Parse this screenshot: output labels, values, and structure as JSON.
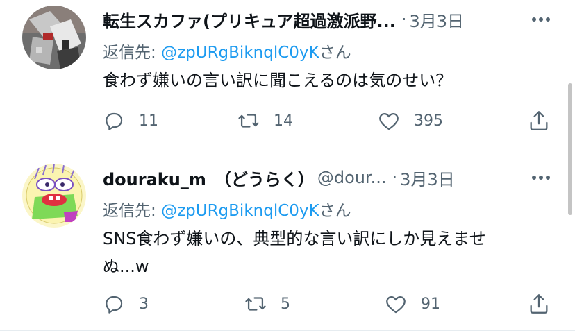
{
  "tweets": [
    {
      "name": "転生スカファ(プリキュア超過激派野...",
      "handle": "",
      "dot": "·",
      "date": "3月3日",
      "reply_prefix": "返信先: ",
      "reply_to": "@zpURgBiknqlC0yK",
      "reply_suffix": "さん",
      "text_lines": [
        "食わず嫌いの言い訳に聞こえるのは気のせい？"
      ],
      "replies": "11",
      "retweets": "14",
      "likes": "395",
      "avatar_icon": "gundam-avatar"
    },
    {
      "name": "douraku_m　（どうらく）",
      "handle": "@dour...",
      "dot": "·",
      "date": "3月3日",
      "reply_prefix": "返信先: ",
      "reply_to": "@zpURgBiknqlC0yK",
      "reply_suffix": "さん",
      "text_lines": [
        "SNS食わず嫌いの、典型的な言い訳にしか見えませ",
        "ぬ...w"
      ],
      "replies": "3",
      "retweets": "5",
      "likes": "91",
      "avatar_icon": "cartoon-face-avatar"
    }
  ],
  "icons": {
    "reply": "reply-icon",
    "retweet": "retweet-icon",
    "like": "like-icon",
    "share": "share-icon",
    "more": "more-icon"
  },
  "colors": {
    "link": "#1d9bf0",
    "muted": "#536471",
    "text": "#0f1419",
    "divider": "#e6ecf0"
  }
}
